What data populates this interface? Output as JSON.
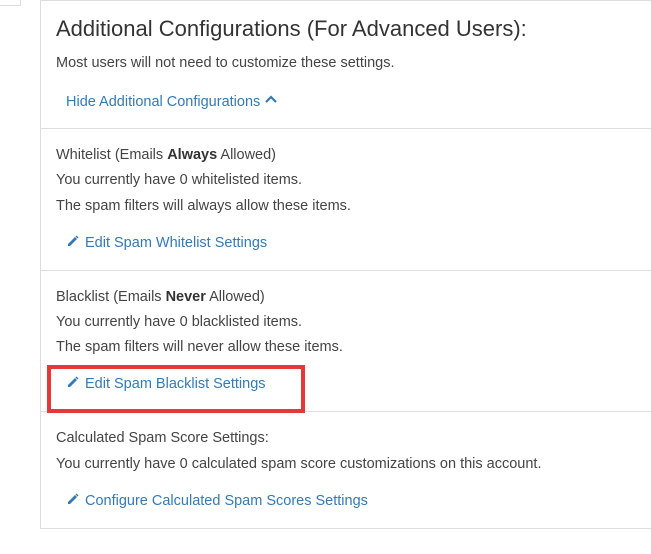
{
  "header": {
    "title": "Additional Configurations (For Advanced Users):",
    "subtitle": "Most users will not need to customize these settings.",
    "hide_link": "Hide Additional Configurations"
  },
  "whitelist": {
    "label_prefix": "Whitelist (Emails ",
    "label_bold": "Always",
    "label_suffix": " Allowed)",
    "count_text": "You currently have 0 whitelisted items.",
    "desc": "The spam filters will always allow these items.",
    "action": "Edit Spam Whitelist Settings"
  },
  "blacklist": {
    "label_prefix": "Blacklist (Emails ",
    "label_bold": "Never",
    "label_suffix": " Allowed)",
    "count_text": "You currently have 0 blacklisted items.",
    "desc": "The spam filters will never allow these items.",
    "action": "Edit Spam Blacklist Settings"
  },
  "score": {
    "label": "Calculated Spam Score Settings:",
    "count_text": "You currently have 0 calculated spam score customizations on this account.",
    "action": "Configure Calculated Spam Scores Settings"
  },
  "colors": {
    "link": "#337ab7",
    "highlight": "#e53935"
  }
}
